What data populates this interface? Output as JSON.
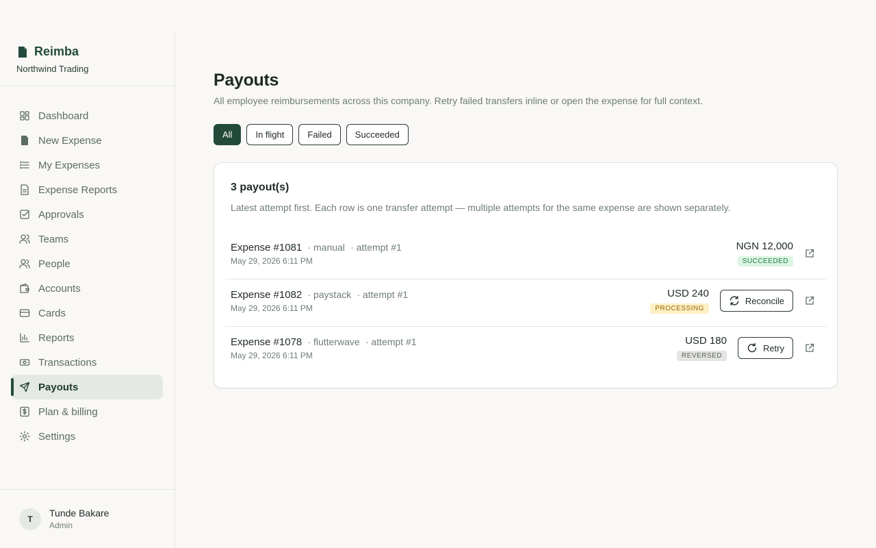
{
  "sidebar": {
    "brand": "Reimba",
    "company": "Northwind Trading",
    "items": [
      {
        "label": "Dashboard",
        "icon": "dashboard-icon"
      },
      {
        "label": "New Expense",
        "icon": "file-icon"
      },
      {
        "label": "My Expenses",
        "icon": "list-icon"
      },
      {
        "label": "Expense Reports",
        "icon": "report-icon"
      },
      {
        "label": "Approvals",
        "icon": "checkbox-icon"
      },
      {
        "label": "Teams",
        "icon": "users-icon"
      },
      {
        "label": "People",
        "icon": "people-icon"
      },
      {
        "label": "Accounts",
        "icon": "wallet-icon"
      },
      {
        "label": "Cards",
        "icon": "card-icon"
      },
      {
        "label": "Reports",
        "icon": "bar-chart-icon"
      },
      {
        "label": "Transactions",
        "icon": "banknote-icon"
      },
      {
        "label": "Payouts",
        "icon": "send-icon",
        "active": true
      },
      {
        "label": "Plan & billing",
        "icon": "dollar-icon"
      },
      {
        "label": "Settings",
        "icon": "gear-icon"
      }
    ],
    "user": {
      "initial": "T",
      "name": "Tunde Bakare",
      "role": "Admin"
    }
  },
  "main": {
    "title": "Payouts",
    "subtitle": "All employee reimbursements across this company. Retry failed transfers inline or open the expense for full context.",
    "filters": [
      "All",
      "In flight",
      "Failed",
      "Succeeded"
    ],
    "active_filter": "All",
    "card": {
      "title": "3 payout(s)",
      "subtitle": "Latest attempt first. Each row is one transfer attempt — multiple attempts for the same expense are shown separately.",
      "rows": [
        {
          "expense": "Expense #1081",
          "provider": "· manual",
          "attempt": "· attempt #1",
          "date": "May 29, 2026 6:11 PM",
          "amount": "NGN 12,000",
          "status": "SUCCEEDED",
          "status_bg": "#dcf5e4",
          "status_fg": "#1e7a44",
          "action": ""
        },
        {
          "expense": "Expense #1082",
          "provider": "· paystack",
          "attempt": "· attempt #1",
          "date": "May 29, 2026 6:11 PM",
          "amount": "USD 240",
          "status": "PROCESSING",
          "status_bg": "#fdf0c4",
          "status_fg": "#9a6a07",
          "action": "Reconcile"
        },
        {
          "expense": "Expense #1078",
          "provider": "· flutterwave",
          "attempt": "· attempt #1",
          "date": "May 29, 2026 6:11 PM",
          "amount": "USD 180",
          "status": "REVERSED",
          "status_bg": "#e4e4e2",
          "status_fg": "#55605a",
          "action": "Retry"
        }
      ]
    }
  },
  "colors": {
    "accent": "#234a3a"
  }
}
